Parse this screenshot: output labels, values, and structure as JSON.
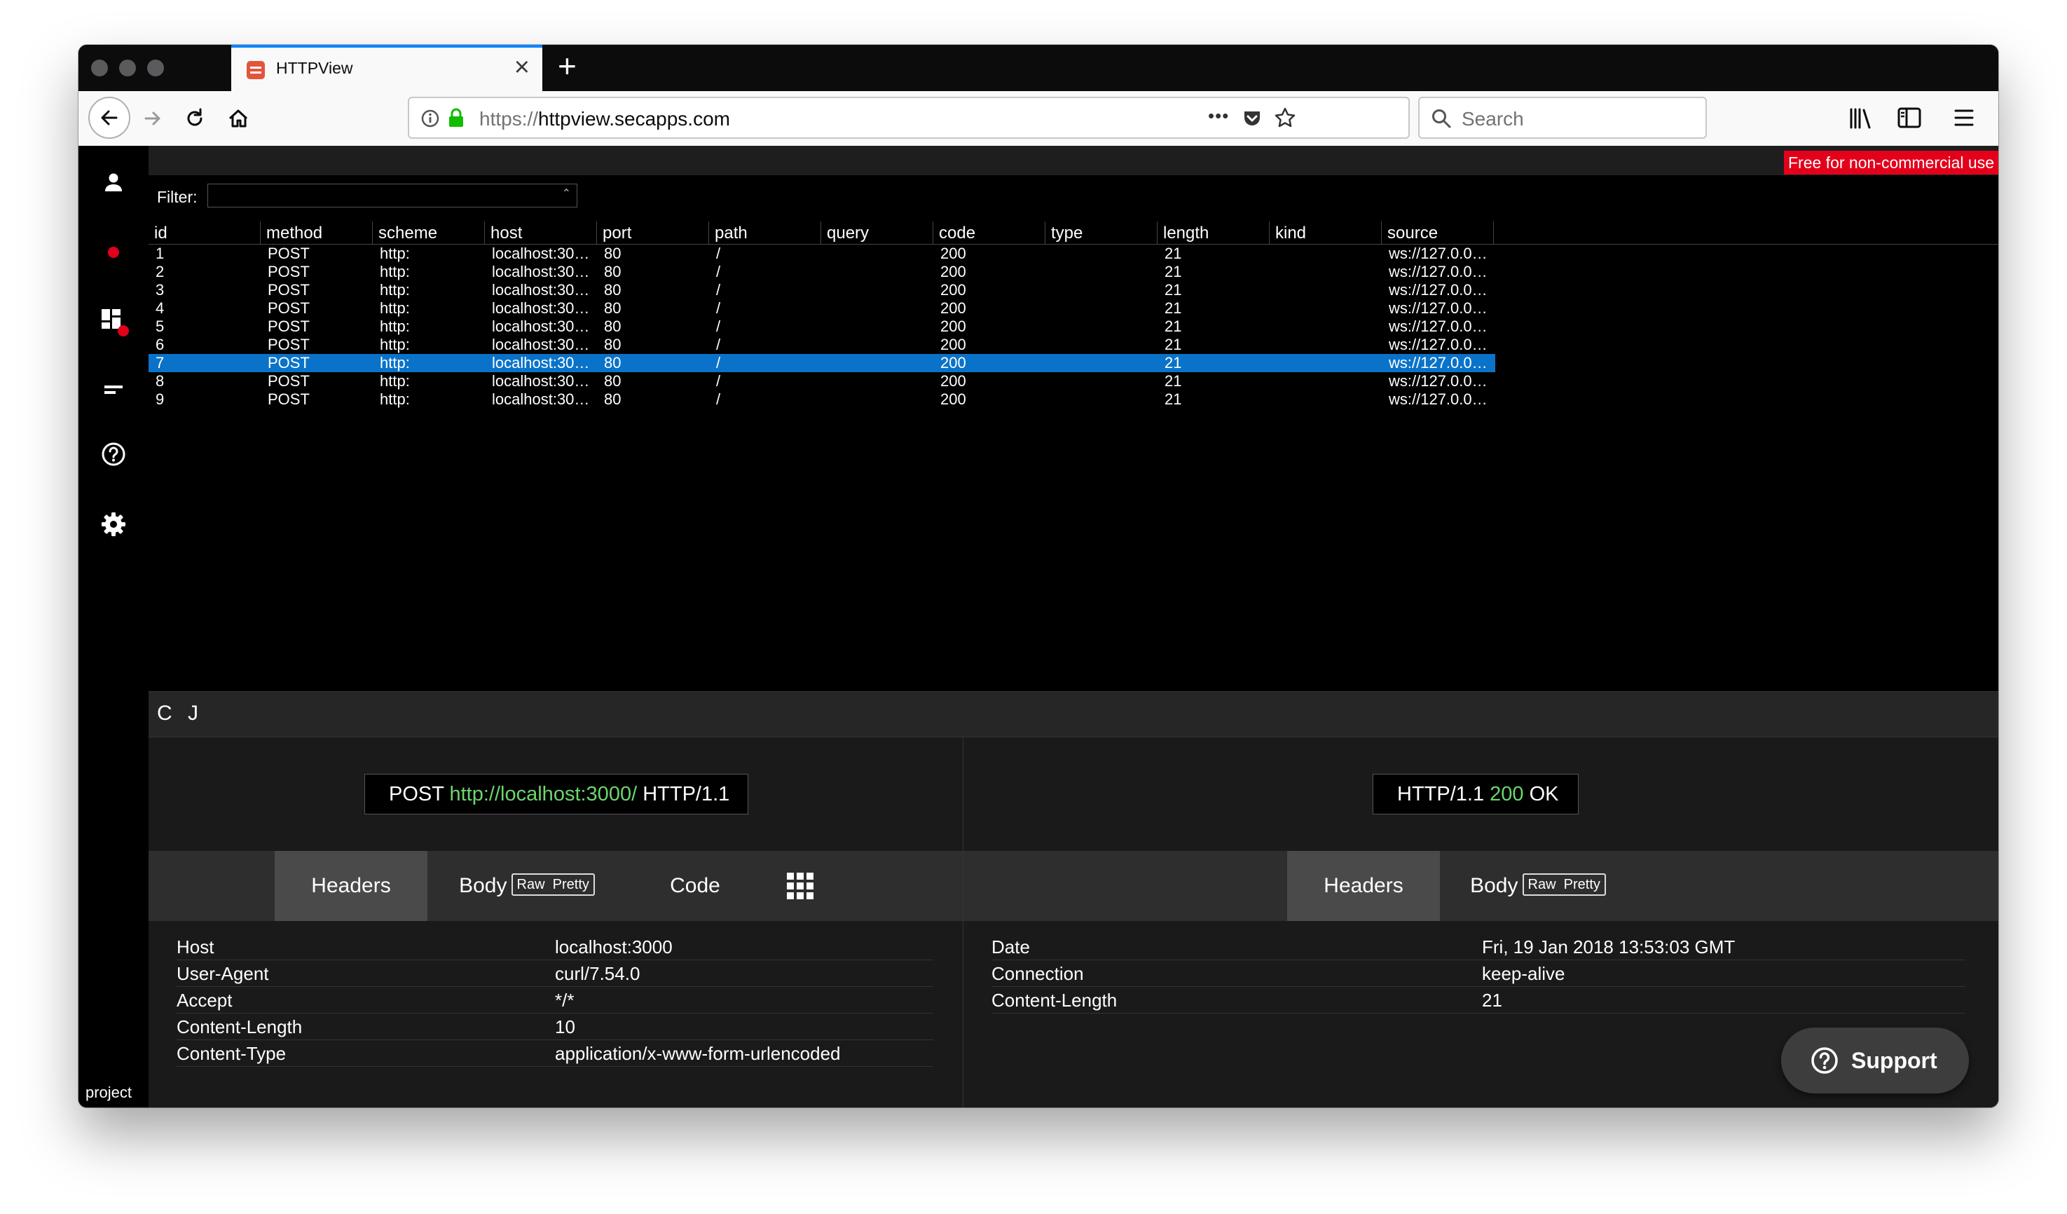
{
  "browser": {
    "tab_title": "HTTPView",
    "url_scheme": "https://",
    "url_host": "httpview.secapps.com",
    "search_placeholder": "Search",
    "menu_dots": "•••"
  },
  "app": {
    "badge": "Free for non-commercial use",
    "filter_label": "Filter:",
    "project_label": "project"
  },
  "table": {
    "columns": [
      "id",
      "method",
      "scheme",
      "host",
      "port",
      "path",
      "query",
      "code",
      "type",
      "length",
      "kind",
      "source"
    ],
    "rows": [
      [
        "1",
        "POST",
        "http:",
        "localhost:30…",
        "80",
        "/",
        "",
        "200",
        "",
        "21",
        "",
        "ws://127.0.0…"
      ],
      [
        "2",
        "POST",
        "http:",
        "localhost:30…",
        "80",
        "/",
        "",
        "200",
        "",
        "21",
        "",
        "ws://127.0.0…"
      ],
      [
        "3",
        "POST",
        "http:",
        "localhost:30…",
        "80",
        "/",
        "",
        "200",
        "",
        "21",
        "",
        "ws://127.0.0…"
      ],
      [
        "4",
        "POST",
        "http:",
        "localhost:30…",
        "80",
        "/",
        "",
        "200",
        "",
        "21",
        "",
        "ws://127.0.0…"
      ],
      [
        "5",
        "POST",
        "http:",
        "localhost:30…",
        "80",
        "/",
        "",
        "200",
        "",
        "21",
        "",
        "ws://127.0.0…"
      ],
      [
        "6",
        "POST",
        "http:",
        "localhost:30…",
        "80",
        "/",
        "",
        "200",
        "",
        "21",
        "",
        "ws://127.0.0…"
      ],
      [
        "7",
        "POST",
        "http:",
        "localhost:30…",
        "80",
        "/",
        "",
        "200",
        "",
        "21",
        "",
        "ws://127.0.0…"
      ],
      [
        "8",
        "POST",
        "http:",
        "localhost:30…",
        "80",
        "/",
        "",
        "200",
        "",
        "21",
        "",
        "ws://127.0.0…"
      ],
      [
        "9",
        "POST",
        "http:",
        "localhost:30…",
        "80",
        "/",
        "",
        "200",
        "",
        "21",
        "",
        "ws://127.0.0…"
      ]
    ],
    "selected_row": 6
  },
  "detail": {
    "c_button": "C",
    "j_button": "J",
    "request_method": "POST",
    "request_url": "http://localhost:3000/",
    "request_version": "HTTP/1.1",
    "response_version": "HTTP/1.1",
    "response_code": "200",
    "response_text": "OK",
    "tabs": {
      "headers": "Headers",
      "body": "Body",
      "raw": "Raw",
      "pretty": "Pretty",
      "code": "Code"
    },
    "request_headers": [
      [
        "Host",
        "localhost:3000"
      ],
      [
        "User-Agent",
        "curl/7.54.0"
      ],
      [
        "Accept",
        "*/*"
      ],
      [
        "Content-Length",
        "10"
      ],
      [
        "Content-Type",
        "application/x-www-form-urlencoded"
      ]
    ],
    "response_headers": [
      [
        "Date",
        "Fri, 19 Jan 2018 13:53:03 GMT"
      ],
      [
        "Connection",
        "keep-alive"
      ],
      [
        "Content-Length",
        "21"
      ]
    ]
  },
  "support": {
    "label": "Support"
  },
  "colors": {
    "selected_row": "#0a73c9",
    "badge": "#e3001b",
    "url_green": "#6cd66c",
    "record_dot": "#e3001b",
    "tab_accent": "#0a84ff"
  }
}
